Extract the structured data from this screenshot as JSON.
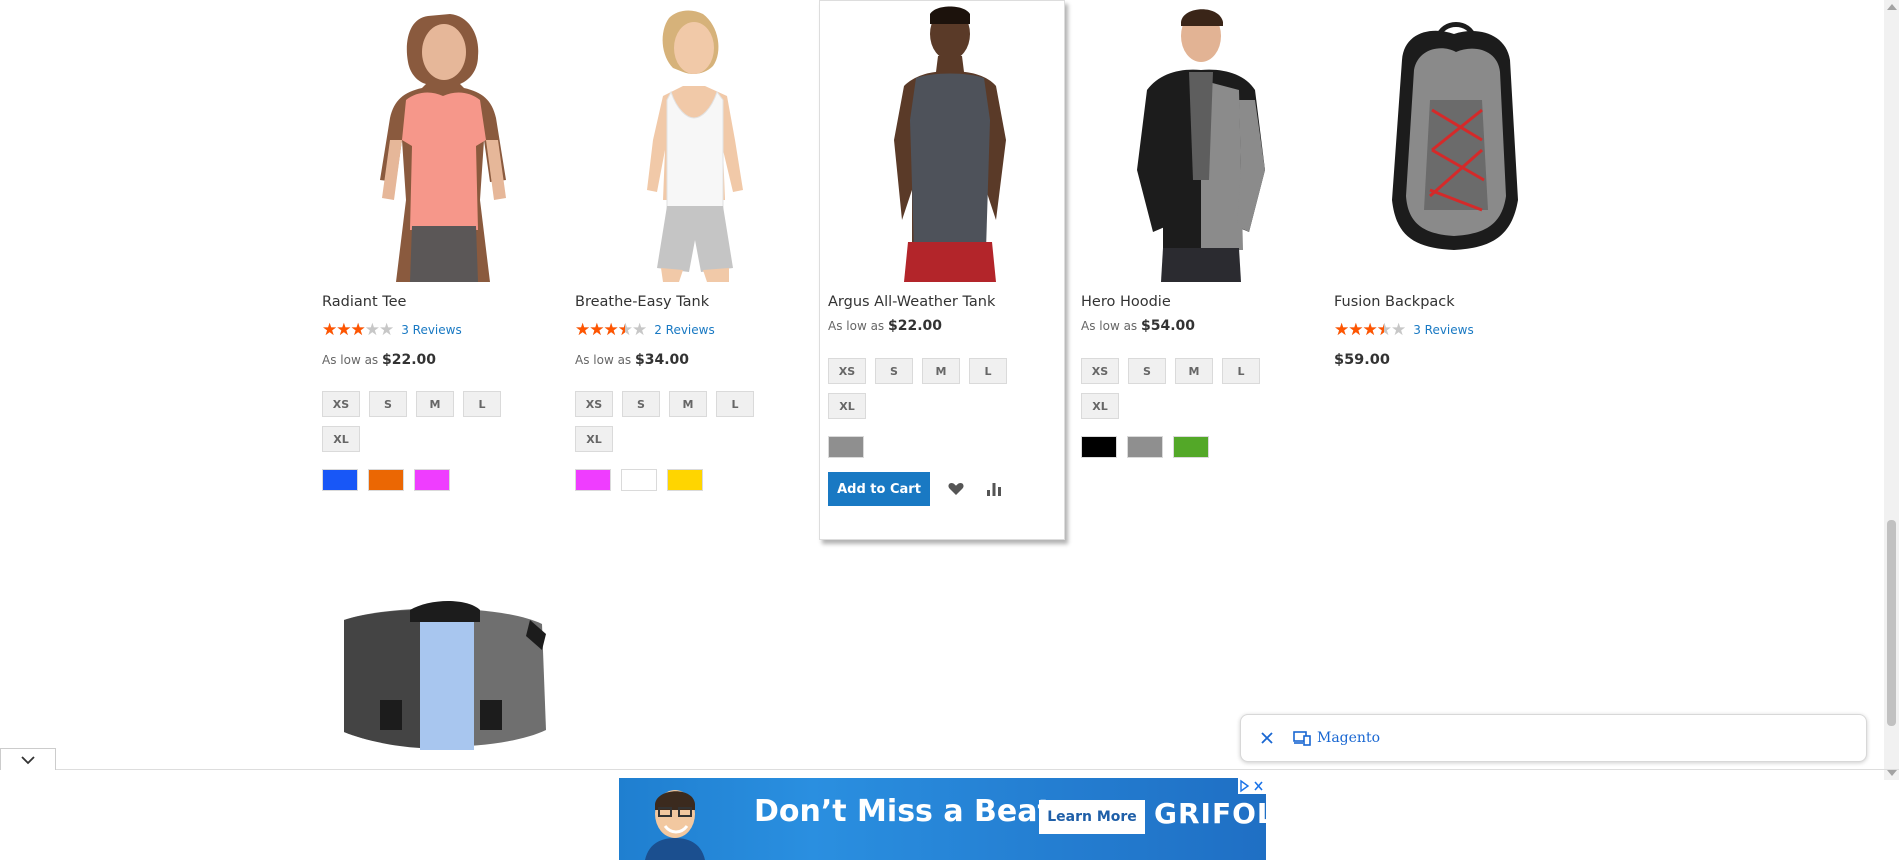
{
  "products": [
    {
      "name": "Radiant Tee",
      "image": "woman-pink-tee-photo",
      "rating_fraction": 0.6,
      "reviews": "3 Reviews",
      "price_prefix": "As low as",
      "price": "$22.00",
      "sizes": [
        "XS",
        "S",
        "M",
        "L",
        "XL"
      ],
      "colors": [
        "#1857f7",
        "#eb6703",
        "#ef3dff"
      ]
    },
    {
      "name": "Breathe-Easy Tank",
      "image": "woman-white-tank-photo",
      "rating_fraction": 0.7,
      "reviews": "2 Reviews",
      "price_prefix": "As low as",
      "price": "$34.00",
      "sizes": [
        "XS",
        "S",
        "M",
        "L",
        "XL"
      ],
      "colors": [
        "#ef3dff",
        "#ffffff",
        "#ffd500"
      ]
    },
    {
      "name": "Argus All-Weather Tank",
      "image": "man-gray-tank-photo",
      "price_prefix": "As low as",
      "price": "$22.00",
      "sizes": [
        "XS",
        "S",
        "M",
        "L",
        "XL"
      ],
      "colors": [
        "#8f8f8f"
      ],
      "add_to_cart": "Add to Cart"
    },
    {
      "name": "Hero Hoodie",
      "image": "man-hoodie-photo",
      "price_prefix": "As low as",
      "price": "$54.00",
      "sizes": [
        "XS",
        "S",
        "M",
        "L",
        "XL"
      ],
      "colors": [
        "#000000",
        "#8f8f8f",
        "#53a828"
      ]
    },
    {
      "name": "Fusion Backpack",
      "image": "gray-backpack-photo",
      "rating_fraction": 0.7,
      "reviews": "3 Reviews",
      "price": "$59.00"
    }
  ],
  "next_row": {
    "image": "messenger-bag-photo"
  },
  "toast": {
    "label": "Magento",
    "close_icon": "close-icon",
    "site_icon": "devices-icon"
  },
  "ad": {
    "headline": "Don’t Miss a Beat",
    "cta": "Learn More",
    "brand": "GRIFOLS"
  }
}
